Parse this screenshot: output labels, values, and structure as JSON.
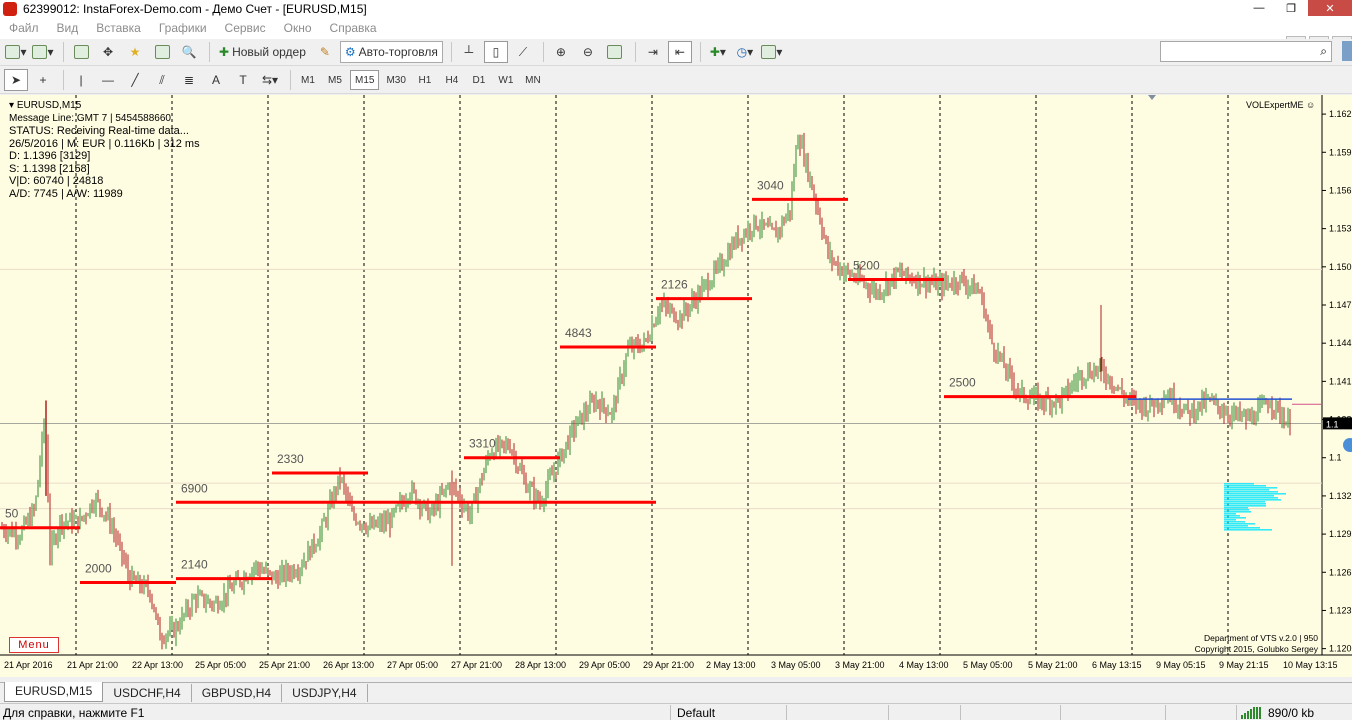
{
  "window": {
    "title": "62399012: InstaForex-Demo.com - Демо Счет - [EURUSD,M15]",
    "buttons": [
      "—",
      "❐",
      "✕"
    ]
  },
  "menu": [
    "Файл",
    "Вид",
    "Вставка",
    "Графики",
    "Сервис",
    "Окно",
    "Справка"
  ],
  "toolbar": {
    "new_order": "Новый ордер",
    "auto_trading": "Авто-торговля",
    "timeframes": [
      "M1",
      "M5",
      "M15",
      "M30",
      "H1",
      "H4",
      "D1",
      "W1",
      "MN"
    ],
    "active_timeframe": "M15",
    "search_placeholder": ""
  },
  "chart": {
    "symbol_label": "EURUSD,M15",
    "info_lines": [
      "Message Line: GMT 7 | 5454588660",
      "STATUS:  Receiving Real-time data...",
      "26/5/2016 | M: EUR | 0.116Kb | 312 ms",
      "D: 1.1396  [3129]",
      "S: 1.1398  [2158]",
      "V|D: 60740 | 24818",
      "A/D: 7745 | A/W: 11989"
    ],
    "indicator_title": "VOLExpertME",
    "menu_button": "Menu",
    "footer": [
      "Department of VTS  v.2.0 | 950",
      "Copyright 2015, Golubko Sergey"
    ],
    "current_price_label": "1.1",
    "colors": {
      "background": "#fffde1",
      "level": "#ff0000",
      "up": "#2e8b2e",
      "down": "#b02020",
      "profile": "#00e5ff"
    }
  },
  "chart_data": {
    "type": "candlestick",
    "symbol": "EURUSD",
    "timeframe": "M15",
    "ylim": [
      1.1195,
      1.1635
    ],
    "y_ticks": [
      "1.162",
      "1.159",
      "1.156",
      "1.153",
      "1.150",
      "1.147",
      "1.144",
      "1.141",
      "1.138",
      "1.1",
      "1.132",
      "1.129",
      "1.126",
      "1.123",
      "1.120"
    ],
    "x_ticks": [
      "21 Apr 2016",
      "21 Apr 21:00",
      "22 Apr 13:00",
      "25 Apr 05:00",
      "25 Apr 21:00",
      "26 Apr 13:00",
      "27 Apr 05:00",
      "27 Apr 21:00",
      "28 Apr 13:00",
      "29 Apr 05:00",
      "29 Apr 21:00",
      "2 May 13:00",
      "3 May 05:00",
      "3 May 21:00",
      "4 May 13:00",
      "5 May 05:00",
      "5 May 21:00",
      "6 May 13:15",
      "9 May 05:15",
      "9 May 21:15",
      "10 May 13:15"
    ],
    "levels": [
      {
        "label": "50",
        "price": 1.1295,
        "from": 0,
        "to": 1
      },
      {
        "label": "2000",
        "price": 1.1252,
        "from": 1,
        "to": 2
      },
      {
        "label": "2140",
        "price": 1.1255,
        "from": 2,
        "to": 3
      },
      {
        "label": "6900",
        "price": 1.1315,
        "from": 2,
        "to": 7
      },
      {
        "label": "2330",
        "price": 1.1338,
        "from": 3,
        "to": 4
      },
      {
        "label": "3310",
        "price": 1.135,
        "from": 5,
        "to": 6
      },
      {
        "label": "4843",
        "price": 1.1437,
        "from": 6,
        "to": 7
      },
      {
        "label": "2126",
        "price": 1.1475,
        "from": 7,
        "to": 8
      },
      {
        "label": "3040",
        "price": 1.1553,
        "from": 8,
        "to": 9
      },
      {
        "label": "5200",
        "price": 1.149,
        "from": 9,
        "to": 10
      },
      {
        "label": "2500",
        "price": 1.1398,
        "from": 10,
        "to": 12
      }
    ],
    "current_price": 1.1377
  },
  "tabs": [
    "EURUSD,M15",
    "USDCHF,H4",
    "GBPUSD,H4",
    "USDJPY,H4"
  ],
  "status": {
    "help": "Для справки, нажмите F1",
    "profile": "Default",
    "traffic": "890/0 kb"
  }
}
